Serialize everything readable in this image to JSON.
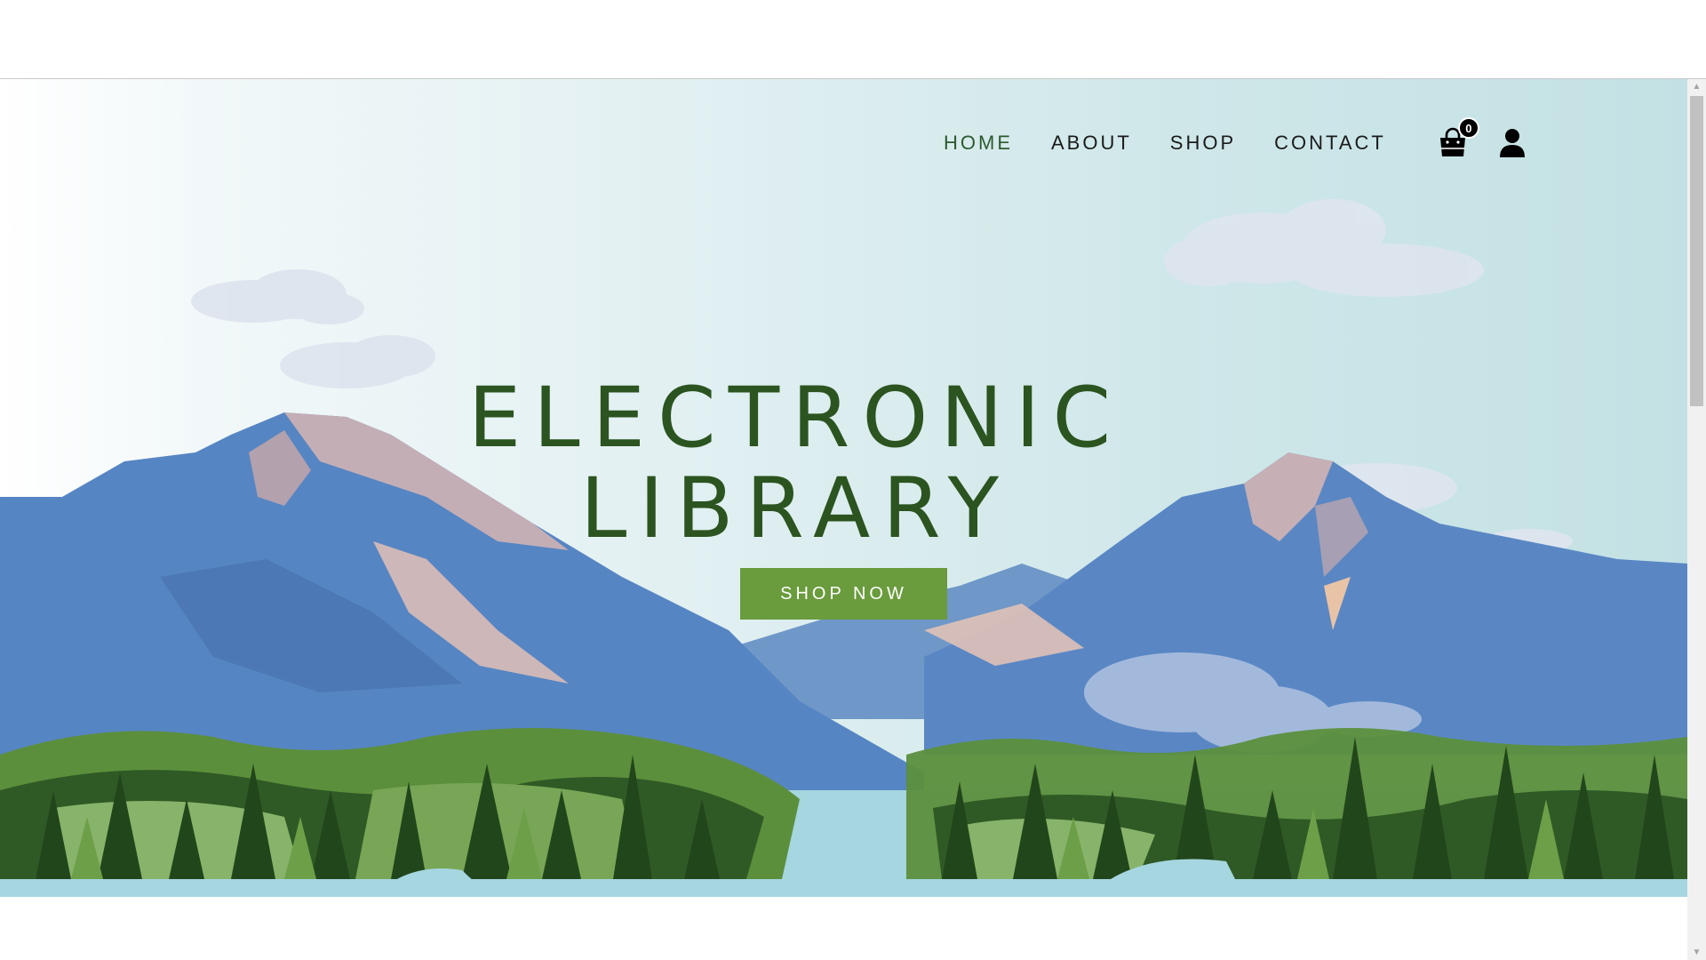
{
  "nav": {
    "items": [
      {
        "label": "HOME",
        "active": true
      },
      {
        "label": "ABOUT",
        "active": false
      },
      {
        "label": "SHOP",
        "active": false
      },
      {
        "label": "CONTACT",
        "active": false
      }
    ],
    "cart_count": "0"
  },
  "hero": {
    "title_line1": "ELECTRONIC",
    "title_line2": "LIBRARY",
    "cta_label": "SHOP NOW"
  },
  "colors": {
    "brand_green": "#2b5420",
    "cta_green": "#6a9b3d",
    "active_nav": "#2c5a2e",
    "sky": "#cfe7e9",
    "mountain_blue": "#5b88c4",
    "water": "#a6d6e0"
  },
  "icons": {
    "cart": "shopping-bag-icon",
    "user": "user-icon",
    "scroll_up": "scroll-up-arrow",
    "scroll_down": "scroll-down-arrow"
  }
}
